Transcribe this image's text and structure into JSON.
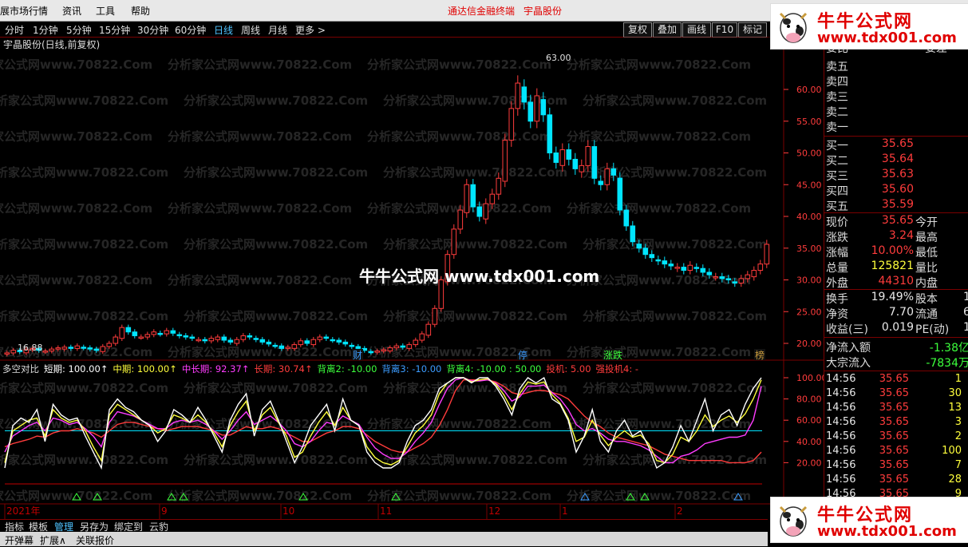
{
  "menubar": {
    "items": [
      "展市场行情",
      "资讯",
      "工具",
      "帮助"
    ],
    "center_title": "通达信金融终端",
    "stock_title": "宇晶股份"
  },
  "periods": {
    "items": [
      "分时",
      "1分钟",
      "5分钟",
      "15分钟",
      "30分钟",
      "60分钟",
      "日线",
      "周线",
      "月线",
      "更多 >"
    ],
    "active": "日线"
  },
  "toolbar": {
    "buttons": [
      "复权",
      "叠加",
      "画线",
      "F10",
      "标记"
    ]
  },
  "chart": {
    "title": "宇晶股份(日线,前复权)",
    "high_label": "63.00",
    "low_label": "16.88",
    "price_axis": [
      "60.00",
      "55.00",
      "50.00",
      "45.00",
      "40.00",
      "35.00",
      "30.00",
      "25.00",
      "20.00"
    ],
    "markers": [
      "财",
      "停",
      "涨跌",
      "榜"
    ],
    "indicator_legend": [
      {
        "text": "多空对比",
        "color": "#dcdcdc"
      },
      {
        "text": "短期: 100.00↑",
        "color": "#ffffff"
      },
      {
        "text": "中期: 100.00↑",
        "color": "#ffff3c"
      },
      {
        "text": "中长期: 92.37↑",
        "color": "#ff3cff"
      },
      {
        "text": "长期: 30.74↑",
        "color": "#ff3c3c"
      },
      {
        "text": "背离2: -10.00",
        "color": "#3cff3c"
      },
      {
        "text": "背离3: -10.00",
        "color": "#3c9cff"
      },
      {
        "text": "背离4: -10.00 : 50.00",
        "color": "#3cff3c"
      },
      {
        "text": "投机: 5.00",
        "color": "#ff3c3c"
      },
      {
        "text": "强投机4: -",
        "color": "#ff3c3c"
      }
    ],
    "indicator_axis": [
      "100.00",
      "80.00",
      "60.00",
      "40.00",
      "20.00"
    ],
    "date_labels": [
      "2021年",
      "9",
      "10",
      "11",
      "12",
      "1",
      "2"
    ],
    "watermark": "分析家公式网www.70822.Com",
    "center_watermark": "牛牛公式网 www.tdx001.com",
    "colors": {
      "up": "#ff3c3c",
      "down": "#00e5ff",
      "short": "#ffffff",
      "mid": "#ffff3c",
      "midlong": "#ff3cff",
      "long": "#ff3c3c",
      "base": "#00e5ff"
    },
    "candles": [
      18.5,
      18.9,
      18.7,
      19.0,
      19.2,
      18.9,
      18.8,
      19.1,
      19.3,
      19.4,
      19.2,
      19.6,
      19.3,
      19.1,
      18.9,
      19.5,
      20.0,
      21.0,
      22.5,
      21.8,
      21.2,
      21.0,
      21.4,
      21.8,
      21.5,
      22.0,
      21.6,
      21.2,
      21.0,
      20.8,
      20.6,
      20.4,
      20.8,
      21.0,
      20.5,
      20.2,
      20.6,
      21.2,
      21.0,
      20.6,
      20.2,
      19.9,
      19.6,
      19.2,
      19.4,
      19.8,
      20.4,
      20.0,
      20.6,
      21.0,
      20.8,
      20.5,
      20.2,
      19.9,
      19.5,
      19.2,
      18.9,
      18.6,
      18.8,
      19.0,
      19.3,
      19.6,
      19.4,
      19.8,
      20.5,
      21.5,
      23.0,
      25.5,
      30.0,
      34.0,
      38.0,
      41.0,
      45.0,
      41.5,
      40.0,
      42.0,
      43.5,
      46.0,
      52.0,
      57.0,
      61.0,
      58.0,
      55.0,
      59.0,
      56.0,
      50.0,
      48.5,
      50.5,
      49.0,
      47.5,
      48.0,
      51.0,
      46.0,
      45.0,
      47.5,
      46.5,
      41.0,
      38.5,
      36.0,
      35.0,
      34.0,
      33.5,
      33.0,
      32.5,
      32.2,
      32.0,
      31.5,
      32.3,
      31.8,
      31.2,
      30.8,
      30.5,
      30.2,
      30.0,
      29.5,
      30.2,
      30.8,
      31.5,
      32.5,
      35.6
    ],
    "short_line": [
      15,
      55,
      62,
      58,
      70,
      40,
      75,
      65,
      60,
      62,
      45,
      30,
      15,
      70,
      80,
      72,
      68,
      60,
      55,
      40,
      50,
      70,
      65,
      58,
      72,
      60,
      45,
      30,
      60,
      75,
      85,
      45,
      70,
      78,
      60,
      40,
      20,
      35,
      55,
      65,
      75,
      50,
      80,
      60,
      55,
      30,
      20,
      15,
      15,
      20,
      40,
      55,
      60,
      70,
      90,
      95,
      100,
      100,
      95,
      100,
      100,
      92,
      80,
      65,
      90,
      100,
      95,
      100,
      80,
      75,
      60,
      30,
      45,
      70,
      40,
      30,
      50,
      60,
      45,
      50,
      35,
      15,
      20,
      35,
      55,
      40,
      60,
      80,
      50,
      65,
      70,
      55,
      75,
      90,
      100
    ],
    "mid_line": [
      20,
      50,
      55,
      60,
      62,
      45,
      70,
      62,
      58,
      60,
      50,
      35,
      22,
      65,
      75,
      70,
      65,
      60,
      55,
      48,
      52,
      65,
      62,
      58,
      65,
      58,
      48,
      35,
      55,
      68,
      78,
      50,
      65,
      72,
      58,
      45,
      25,
      30,
      45,
      58,
      68,
      55,
      72,
      60,
      55,
      35,
      25,
      20,
      18,
      22,
      35,
      48,
      55,
      65,
      85,
      95,
      100,
      100,
      96,
      98,
      99,
      94,
      84,
      70,
      85,
      96,
      94,
      96,
      84,
      76,
      62,
      40,
      44,
      60,
      46,
      36,
      44,
      50,
      44,
      46,
      38,
      22,
      20,
      28,
      44,
      40,
      50,
      65,
      54,
      60,
      64,
      58,
      66,
      80,
      98
    ],
    "midlong_line": [
      30,
      45,
      50,
      55,
      58,
      50,
      62,
      60,
      56,
      58,
      52,
      45,
      35,
      58,
      68,
      66,
      64,
      60,
      56,
      52,
      52,
      58,
      60,
      58,
      60,
      56,
      50,
      42,
      50,
      60,
      68,
      56,
      60,
      64,
      58,
      50,
      38,
      35,
      40,
      50,
      58,
      56,
      64,
      60,
      56,
      44,
      34,
      28,
      24,
      24,
      30,
      40,
      48,
      58,
      75,
      90,
      98,
      100,
      97,
      97,
      98,
      95,
      88,
      78,
      82,
      92,
      92,
      93,
      86,
      80,
      70,
      56,
      50,
      52,
      48,
      42,
      40,
      40,
      38,
      36,
      32,
      26,
      20,
      20,
      26,
      28,
      32,
      38,
      40,
      42,
      44,
      44,
      46,
      60,
      92
    ],
    "long_line": [
      35,
      38,
      40,
      42,
      45,
      44,
      48,
      50,
      50,
      52,
      50,
      48,
      44,
      50,
      56,
      58,
      58,
      56,
      54,
      52,
      50,
      52,
      54,
      54,
      54,
      52,
      50,
      46,
      46,
      50,
      54,
      52,
      52,
      54,
      52,
      48,
      44,
      40,
      40,
      44,
      48,
      50,
      54,
      54,
      52,
      46,
      40,
      36,
      32,
      30,
      30,
      34,
      38,
      44,
      55,
      70,
      88,
      98,
      98,
      98,
      98,
      96,
      92,
      86,
      84,
      86,
      88,
      88,
      86,
      84,
      80,
      72,
      64,
      58,
      54,
      48,
      44,
      42,
      40,
      38,
      36,
      32,
      28,
      26,
      24,
      22,
      22,
      22,
      22,
      22,
      20,
      20,
      20,
      22,
      30
    ]
  },
  "rpanel": {
    "top_cut": {
      "label": "委比",
      "value": "100.00%",
      "label2": "委差"
    },
    "sells": [
      {
        "label": "卖五"
      },
      {
        "label": "卖四"
      },
      {
        "label": "卖三"
      },
      {
        "label": "卖二"
      },
      {
        "label": "卖一"
      }
    ],
    "buys": [
      {
        "label": "买一",
        "price": "35.65"
      },
      {
        "label": "买二",
        "price": "35.64"
      },
      {
        "label": "买三",
        "price": "35.63"
      },
      {
        "label": "买四",
        "price": "35.60"
      },
      {
        "label": "买五",
        "price": "35.59"
      }
    ],
    "stats": [
      {
        "label": "现价",
        "value": "35.65",
        "label2": "今开",
        "cls": "red"
      },
      {
        "label": "涨跌",
        "value": "3.24",
        "label2": "最高",
        "cls": "red"
      },
      {
        "label": "涨幅",
        "value": "10.00%",
        "label2": "最低",
        "cls": "red"
      },
      {
        "label": "总量",
        "value": "125821",
        "label2": "量比",
        "cls": "yel"
      },
      {
        "label": "外盘",
        "value": "44310",
        "label2": "内盘",
        "cls": "red"
      }
    ],
    "stats2": [
      {
        "label": "换手",
        "value": "19.49%",
        "label2": "股本",
        "v2": "1"
      },
      {
        "label": "净资",
        "value": "7.70",
        "label2": "流通",
        "v2": "6"
      },
      {
        "label": "收益(三)",
        "value": "0.019",
        "label2": "PE(动)",
        "v2": "1"
      }
    ],
    "flows": [
      {
        "label": "净流入额",
        "value": "-1.38亿"
      },
      {
        "label": "大宗流入",
        "value": "-7834万"
      }
    ],
    "ticks": [
      {
        "time": "14:56",
        "price": "35.65",
        "vol": "1"
      },
      {
        "time": "14:56",
        "price": "35.65",
        "vol": "30"
      },
      {
        "time": "14:56",
        "price": "35.65",
        "vol": "13"
      },
      {
        "time": "14:56",
        "price": "35.65",
        "vol": "3"
      },
      {
        "time": "14:56",
        "price": "35.65",
        "vol": "2"
      },
      {
        "time": "14:56",
        "price": "35.65",
        "vol": "100"
      },
      {
        "time": "14:56",
        "price": "35.65",
        "vol": "7"
      },
      {
        "time": "14:56",
        "price": "35.65",
        "vol": "28"
      },
      {
        "time": "14:56",
        "price": "35.65",
        "vol": "9"
      }
    ]
  },
  "bottom_tabs": {
    "items": [
      "指标",
      "模板",
      "管理",
      "另存为",
      "绑定到",
      "云豹"
    ],
    "active": "管理"
  },
  "statusbar": {
    "items": [
      "开弹幕",
      "扩展∧",
      "关联报价"
    ]
  },
  "logo": {
    "title": "牛牛公式网",
    "url": "www.tdx001.com"
  }
}
